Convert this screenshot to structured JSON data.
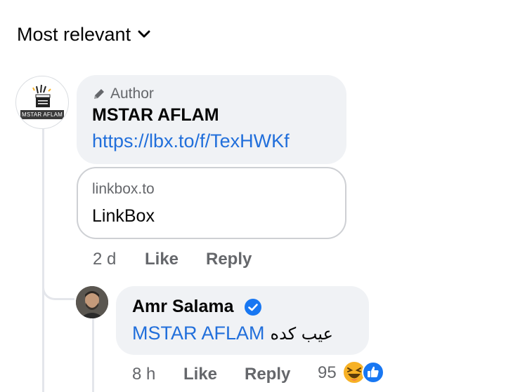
{
  "sort": {
    "label": "Most relevant"
  },
  "comment": {
    "author_badge": "Author",
    "name": "MSTAR AFLAM",
    "avatar_text": "MSTAR AFLAM",
    "link": "https://lbx.to/f/TexHWKf",
    "preview": {
      "domain": "linkbox.to",
      "title": "LinkBox"
    },
    "time": "2 d",
    "like_label": "Like",
    "reply_label": "Reply"
  },
  "reply": {
    "name": "Amr Salama",
    "verified": true,
    "mention": "MSTAR AFLAM",
    "text": "عيب كده",
    "time": "8 h",
    "like_label": "Like",
    "reply_label": "Reply",
    "reaction_count": "95",
    "reactions": [
      "haha-icon",
      "like-icon"
    ]
  },
  "colors": {
    "link": "#216fdb",
    "secondary_text": "#65676b",
    "bubble": "#f0f2f5",
    "verified": "#1877f2",
    "haha": "#f7b125",
    "like": "#1877f2"
  }
}
